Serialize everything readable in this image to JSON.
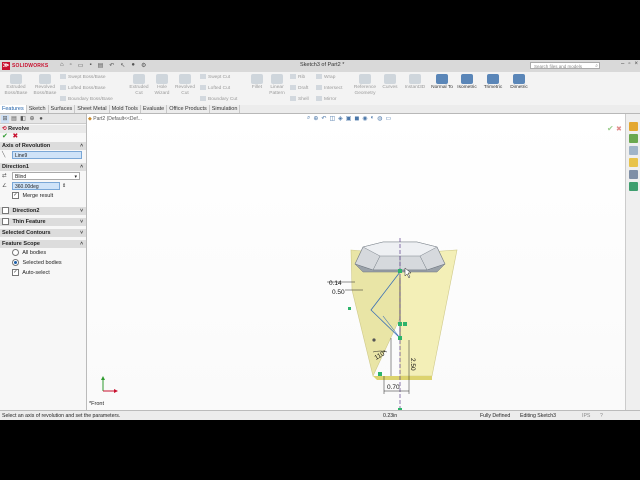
{
  "app": {
    "logo_text": "SOLIDWORKS",
    "window_title": "Sketch3 of Part2 *",
    "search_placeholder": "Search files and models"
  },
  "ribbon": {
    "extruded_boss": "Extruded Boss/Base",
    "revolved_boss": "Revolved Boss/Base",
    "swept_boss": "Swept Boss/Base",
    "lofted_boss": "Lofted Boss/Base",
    "boundary_boss": "Boundary Boss/Base",
    "extruded_cut": "Extruded Cut",
    "hole_wizard": "Hole Wizard",
    "revolved_cut": "Revolved Cut",
    "swept_cut": "Swept Cut",
    "lofted_cut": "Lofted Cut",
    "boundary_cut": "Boundary Cut",
    "fillet": "Fillet",
    "linear_pattern": "Linear Pattern",
    "rib": "Rib",
    "draft": "Draft",
    "shell": "Shell",
    "wrap": "Wrap",
    "intersect": "Intersect",
    "mirror": "Mirror",
    "reference_geometry": "Reference Geometry",
    "curves": "Curves",
    "instant3d": "Instant3D",
    "normal_to": "Normal To",
    "isometric": "Isometric",
    "trimetric": "Trimetric",
    "dimetric": "Dimetric"
  },
  "tabs": [
    "Features",
    "Sketch",
    "Surfaces",
    "Sheet Metal",
    "Mold Tools",
    "Evaluate",
    "Office Products",
    "Simulation"
  ],
  "panel": {
    "feature_title": "Revolve",
    "axis_section": "Axis of Revolution",
    "axis_value": "Line9",
    "direction1_section": "Direction1",
    "end_condition": "Blind",
    "angle_value": "360.00deg",
    "merge_result": "Merge result",
    "direction2_section": "Direction2",
    "thin_feature": "Thin Feature",
    "selected_contours": "Selected Contours",
    "feature_scope": "Feature Scope",
    "all_bodies": "All bodies",
    "selected_bodies": "Selected bodies",
    "auto_select": "Auto-select"
  },
  "viewport": {
    "breadcrumb": "Part2 (Default<<Def...",
    "view_name": "*Front",
    "dims": {
      "d1": "0.14",
      "d2": "0.50",
      "d3": "2.50",
      "d4": "110°",
      "d5": "0.70"
    }
  },
  "status": {
    "message": "Select an axis of revolution and set the parameters.",
    "coord": "0.23in",
    "state": "Fully Defined",
    "editing": "Editing Sketch3",
    "units": "IPS"
  },
  "colors": {
    "accent": "#1d5fa8",
    "logo_red": "#c8102e",
    "preview_yellow": "#f1ecae",
    "sketch_green": "#2db36a"
  }
}
